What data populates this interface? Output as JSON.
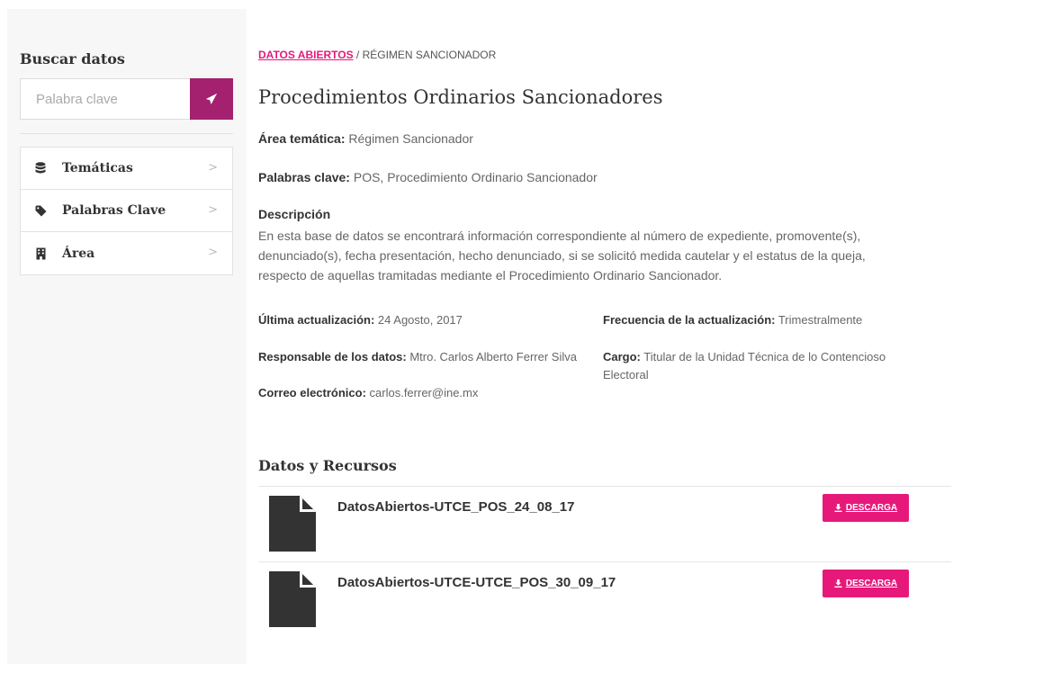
{
  "sidebar": {
    "title": "Buscar datos",
    "search_placeholder": "Palabra clave",
    "items": [
      {
        "label": "Temáticas",
        "icon": "database-icon"
      },
      {
        "label": "Palabras Clave",
        "icon": "tag-icon"
      },
      {
        "label": "Área",
        "icon": "building-icon"
      }
    ]
  },
  "breadcrumb": {
    "root": "DATOS ABIERTOS",
    "separator": " / ",
    "current": "RÉGIMEN SANCIONADOR"
  },
  "page": {
    "title": "Procedimientos Ordinarios Sancionadores",
    "area_label": "Área temática:",
    "area_value": " Régimen Sancionador",
    "keywords_label": "Palabras clave:",
    "keywords_value": " POS, Procedimiento Ordinario Sancionador",
    "description_label": "Descripción",
    "description_text": "En esta base de datos se encontrará información correspondiente al número de expediente, promovente(s), denunciado(s), fecha presentación, hecho denunciado, si se solicitó medida cautelar y el estatus de la queja, respecto de aquellas tramitadas mediante el Procedimiento Ordinario Sancionador."
  },
  "metadata": {
    "updated_label": "Última actualización:",
    "updated_value": " 24 Agosto, 2017",
    "frequency_label": "Frecuencia de la actualización:",
    "frequency_value": " Trimestralmente",
    "owner_label": "Responsable de los datos:",
    "owner_value": " Mtro. Carlos Alberto Ferrer Silva",
    "position_label": "Cargo:",
    "position_value": " Titular de la Unidad Técnica de lo Contencioso Electoral",
    "email_label": "Correo electrónico:",
    "email_value": " carlos.ferrer@ine.mx"
  },
  "resources": {
    "title": "Datos y Recursos",
    "download_label": "DESCARGA",
    "items": [
      {
        "name": "DatosAbiertos-UTCE_POS_24_08_17"
      },
      {
        "name": "DatosAbiertos-UTCE-UTCE_POS_30_09_17"
      }
    ]
  },
  "colors": {
    "accent_pink": "#e6197b",
    "search_button": "#a3216e"
  }
}
